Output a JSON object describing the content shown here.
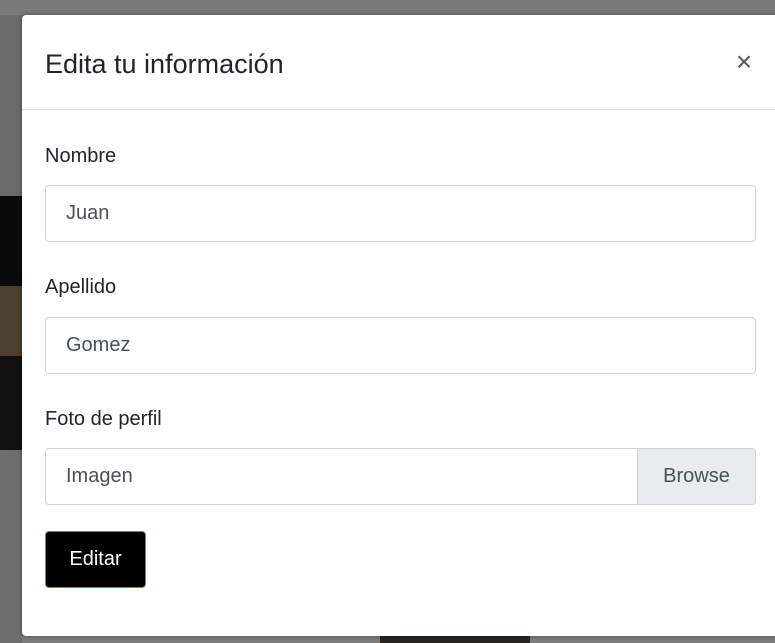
{
  "modal": {
    "title": "Edita tu información",
    "close_icon": "close-icon",
    "close_glyph": "×"
  },
  "form": {
    "nombre": {
      "label": "Nombre",
      "value": "Juan"
    },
    "apellido": {
      "label": "Apellido",
      "value": "Gomez"
    },
    "foto": {
      "label": "Foto de perfil",
      "placeholder": "Imagen",
      "browse_label": "Browse"
    },
    "submit_label": "Editar"
  },
  "colors": {
    "submit_background": "#000000",
    "submit_border": "#1fa3b5",
    "browse_background": "#e9ecef",
    "input_border": "#ced4da"
  }
}
